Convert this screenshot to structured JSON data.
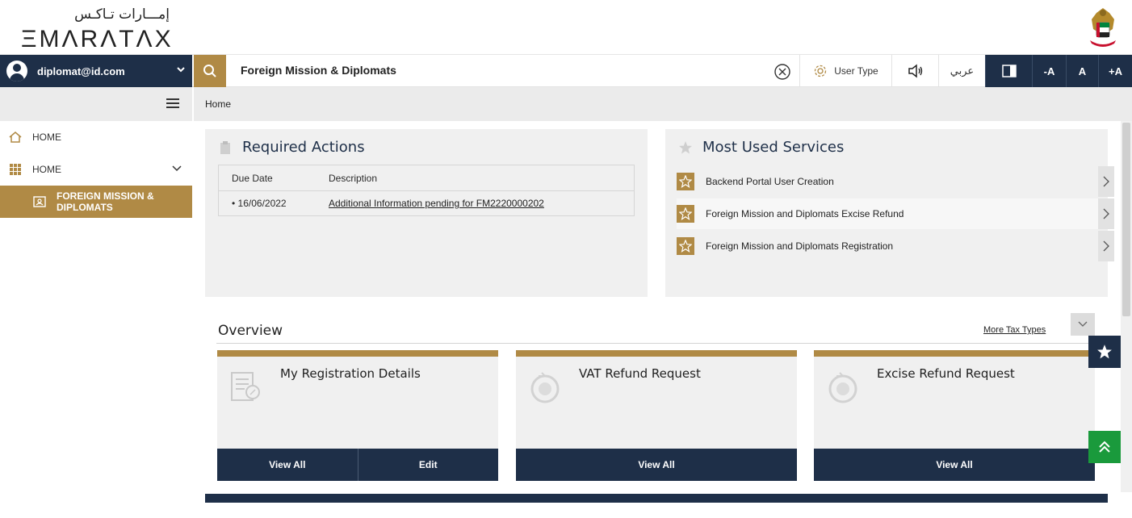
{
  "header": {
    "logo_arabic": "إمـــارات تـاكـس",
    "logo_english": "ΞMΛRΛTΛX"
  },
  "toolbar": {
    "user_email": "diplomat@id.com",
    "search_text": "Foreign Mission & Diplomats",
    "user_type_label": "User Type",
    "arabic_label": "عربي",
    "font_decrease": "-A",
    "font_normal": "A",
    "font_increase": "+A"
  },
  "sidebar": {
    "items": [
      {
        "label": "HOME",
        "icon": "home-icon"
      },
      {
        "label": "HOME",
        "icon": "grid-icon"
      }
    ],
    "active_item": "FOREIGN MISSION & DIPLOMATS"
  },
  "breadcrumb": {
    "current": "Home"
  },
  "required_actions": {
    "title": "Required Actions",
    "columns": [
      "Due Date",
      "Description"
    ],
    "rows": [
      {
        "due_date": "• 16/06/2022",
        "description": "Additional Information pending for FM2220000202"
      }
    ]
  },
  "most_used_services": {
    "title": "Most Used Services",
    "items": [
      "Backend Portal User Creation",
      "Foreign Mission and Diplomats Excise Refund",
      "Foreign Mission and Diplomats Registration"
    ]
  },
  "overview": {
    "title": "Overview",
    "more_tax_types": "More Tax Types",
    "cards": [
      {
        "title": "My Registration Details",
        "buttons": [
          "View All",
          "Edit"
        ]
      },
      {
        "title": "VAT Refund Request",
        "buttons": [
          "View All"
        ]
      },
      {
        "title": "Excise Refund Request",
        "buttons": [
          "View All"
        ]
      }
    ]
  },
  "colors": {
    "navy": "#1e2f48",
    "gold": "#b08a45",
    "panel": "#f0f0f0",
    "green": "#1a9a3c"
  }
}
